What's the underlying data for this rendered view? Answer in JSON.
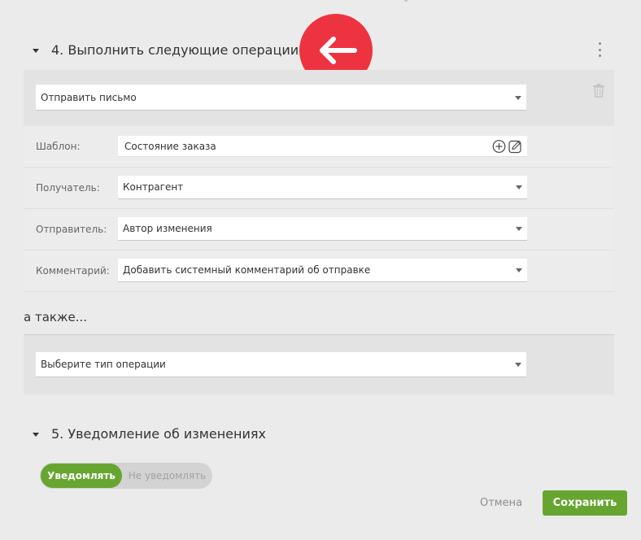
{
  "section4": {
    "title": "4. Выполнить следующие операции",
    "operation_select": "Отправить письмо",
    "params": [
      {
        "label": "Шаблон:",
        "value": "Состояние заказа"
      },
      {
        "label": "Получатель:",
        "value": "Контрагент"
      },
      {
        "label": "Отправитель:",
        "value": "Автор изменения"
      },
      {
        "label": "Комментарий:",
        "value": "Добавить системный комментарий об отправке"
      }
    ],
    "also_label": "а также...",
    "next_operation_select": "Выберите тип операции"
  },
  "section5": {
    "title": "5. Уведомление об изменениях",
    "toggle_on": "Уведомлять",
    "toggle_off": "Не уведомлять",
    "toggle_selected": "Уведомлять"
  },
  "footer": {
    "cancel_label": "Отмена",
    "save_label": "Сохранить"
  },
  "colors": {
    "accent_green": "#67a531",
    "back_red": "#ee3340",
    "background": "#ebebeb"
  },
  "icons": {
    "back": "arrow-left-icon",
    "menu": "kebab-menu-icon",
    "delete": "trash-icon",
    "add": "plus-circle-icon",
    "edit": "edit-icon"
  }
}
